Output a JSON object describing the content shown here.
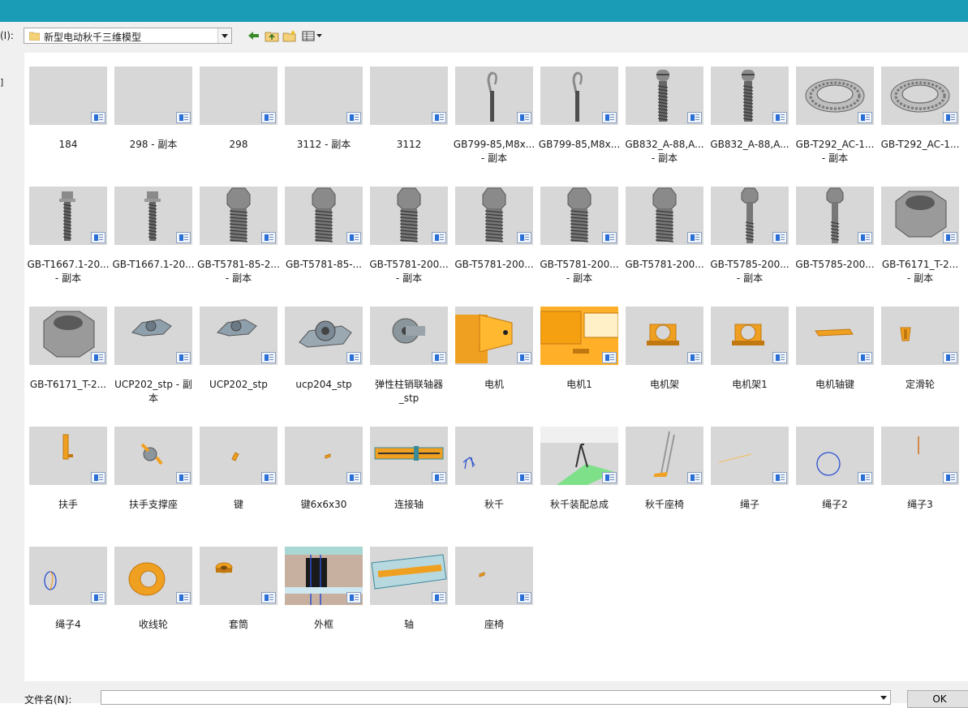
{
  "toolbar": {
    "look_in_label": "(I):",
    "look_in_value": "新型电动秋千三维模型"
  },
  "left_strip": {
    "label": "]"
  },
  "files": [
    {
      "name": "184",
      "icon": "blank"
    },
    {
      "name": "298 - 副本",
      "icon": "blank"
    },
    {
      "name": "298",
      "icon": "blank"
    },
    {
      "name": "3112 - 副本",
      "icon": "blank"
    },
    {
      "name": "3112",
      "icon": "blank"
    },
    {
      "name": "GB799-85,M8x...\n- 副本",
      "icon": "hook-bolt"
    },
    {
      "name": "GB799-85,M8x...",
      "icon": "hook-bolt"
    },
    {
      "name": "GB832_A-88,A...\n- 副本",
      "icon": "slotted-screw"
    },
    {
      "name": "GB832_A-88,A...",
      "icon": "slotted-screw"
    },
    {
      "name": "GB-T292_AC-1...\n- 副本",
      "icon": "bearing"
    },
    {
      "name": "GB-T292_AC-1...",
      "icon": "bearing"
    },
    {
      "name": "GB-T1667.1-20...\n- 副本",
      "icon": "flange-bolt"
    },
    {
      "name": "GB-T1667.1-20...",
      "icon": "flange-bolt"
    },
    {
      "name": "GB-T5781-85-2...\n- 副本",
      "icon": "hex-bolt"
    },
    {
      "name": "GB-T5781-85-...",
      "icon": "hex-bolt"
    },
    {
      "name": "GB-T5781-200...\n- 副本",
      "icon": "hex-bolt"
    },
    {
      "name": "GB-T5781-200...",
      "icon": "hex-bolt"
    },
    {
      "name": "GB-T5781-200...\n- 副本",
      "icon": "hex-bolt"
    },
    {
      "name": "GB-T5781-200...",
      "icon": "hex-bolt"
    },
    {
      "name": "GB-T5785-200...\n- 副本",
      "icon": "long-bolt"
    },
    {
      "name": "GB-T5785-200...",
      "icon": "long-bolt"
    },
    {
      "name": "GB-T6171_T-2...\n- 副本",
      "icon": "hex-nut"
    },
    {
      "name": "GB-T6171_T-2...",
      "icon": "hex-nut"
    },
    {
      "name": "UCP202_stp - 副\n本",
      "icon": "pillow-block-small"
    },
    {
      "name": "UCP202_stp",
      "icon": "pillow-block-small"
    },
    {
      "name": "ucp204_stp",
      "icon": "pillow-block"
    },
    {
      "name": "弹性柱销联轴器\n_stp",
      "icon": "coupling"
    },
    {
      "name": "电机",
      "icon": "motor"
    },
    {
      "name": "电机1",
      "icon": "motor-1"
    },
    {
      "name": "电机架",
      "icon": "motor-mount"
    },
    {
      "name": "电机架1",
      "icon": "motor-mount"
    },
    {
      "name": "电机轴键",
      "icon": "shaft-key"
    },
    {
      "name": "定滑轮",
      "icon": "pulley"
    },
    {
      "name": "扶手",
      "icon": "handrail"
    },
    {
      "name": "扶手支撑座",
      "icon": "handrail-support"
    },
    {
      "name": "键",
      "icon": "key"
    },
    {
      "name": "键6x6x30",
      "icon": "key-small"
    },
    {
      "name": "连接轴",
      "icon": "connecting-shaft"
    },
    {
      "name": "秋千",
      "icon": "swing"
    },
    {
      "name": "秋千装配总成",
      "icon": "swing-assembly"
    },
    {
      "name": "秋千座椅",
      "icon": "swing-seat"
    },
    {
      "name": "绳子",
      "icon": "rope"
    },
    {
      "name": "绳子2",
      "icon": "rope-ring"
    },
    {
      "name": "绳子3",
      "icon": "rope-vertical"
    },
    {
      "name": "绳子4",
      "icon": "rope-small-ring"
    },
    {
      "name": "收线轮",
      "icon": "reel"
    },
    {
      "name": "套筒",
      "icon": "sleeve"
    },
    {
      "name": "外框",
      "icon": "outer-frame"
    },
    {
      "name": "轴",
      "icon": "shaft"
    },
    {
      "name": "座椅",
      "icon": "seat"
    }
  ],
  "bottom": {
    "filename_label": "文件名(N):",
    "filename_value": "",
    "ok_label": "OK"
  }
}
